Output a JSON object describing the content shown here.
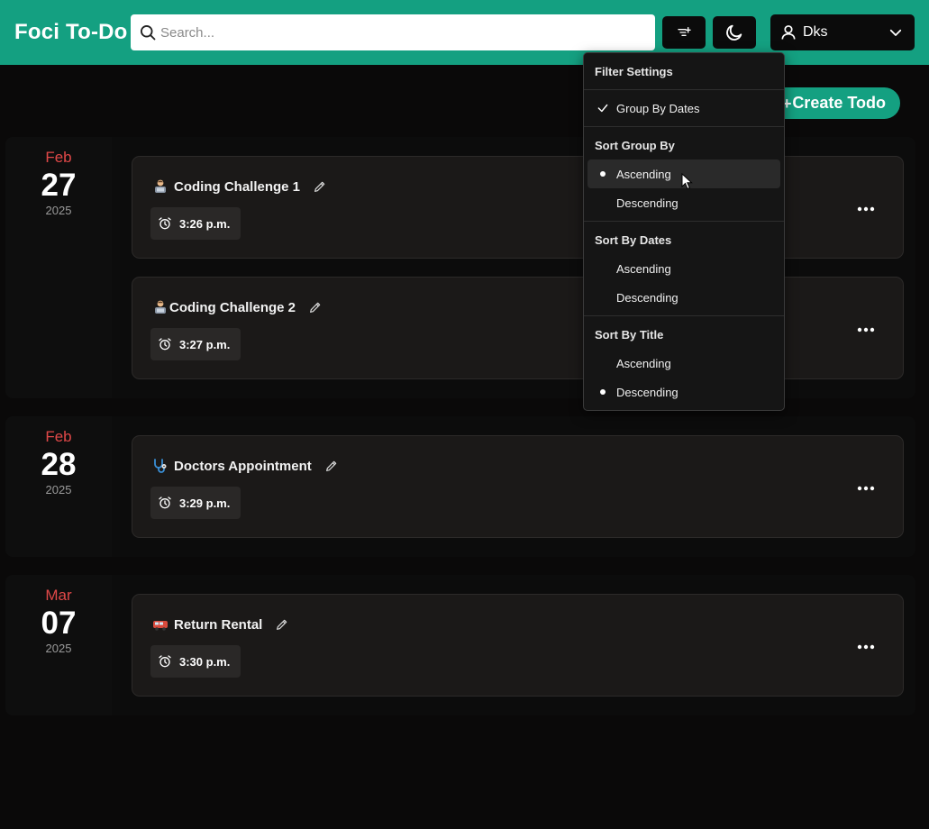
{
  "header": {
    "brand": "Foci To-Do",
    "search_placeholder": "Search...",
    "user_name": "Dks",
    "colors": {
      "brand": "#14a081",
      "background": "#0a0909"
    }
  },
  "main": {
    "create_button_label": "Create Todo"
  },
  "groups": [
    {
      "month": "Feb",
      "day": "27",
      "year": "2025",
      "todos": [
        {
          "emoji": "technologist-emoji",
          "title": "Coding Challenge 1",
          "time": "3:26 p.m."
        },
        {
          "emoji": "technologist-emoji",
          "title": "Coding Challenge 2",
          "time": "3:27 p.m."
        }
      ]
    },
    {
      "month": "Feb",
      "day": "28",
      "year": "2025",
      "todos": [
        {
          "emoji": "stethoscope-emoji",
          "title": "Doctors Appointment",
          "time": "3:29 p.m."
        }
      ]
    },
    {
      "month": "Mar",
      "day": "07",
      "year": "2025",
      "todos": [
        {
          "emoji": "minibus-emoji",
          "title": "Return Rental",
          "time": "3:30 p.m."
        }
      ]
    }
  ],
  "filter_menu": {
    "title": "Filter Settings",
    "group_by_dates": {
      "label": "Group By Dates",
      "checked": true
    },
    "sort_group_by": {
      "heading": "Sort Group By",
      "options": [
        {
          "label": "Ascending",
          "selected": true
        },
        {
          "label": "Descending",
          "selected": false
        }
      ]
    },
    "sort_by_dates": {
      "heading": "Sort By Dates",
      "options": [
        {
          "label": "Ascending",
          "selected": false
        },
        {
          "label": "Descending",
          "selected": false
        }
      ]
    },
    "sort_by_title": {
      "heading": "Sort By Title",
      "options": [
        {
          "label": "Ascending",
          "selected": false
        },
        {
          "label": "Descending",
          "selected": true
        }
      ]
    }
  }
}
